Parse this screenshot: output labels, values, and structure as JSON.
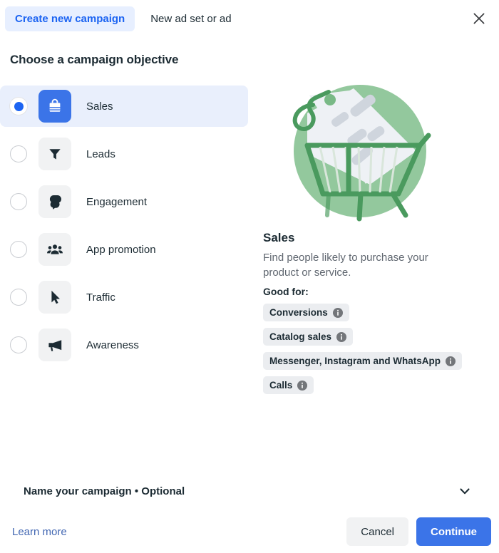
{
  "header": {
    "tabs": [
      {
        "label": "Create new campaign",
        "active": true
      },
      {
        "label": "New ad set or ad",
        "active": false
      }
    ],
    "close_icon": "close-icon"
  },
  "section": {
    "title": "Choose a campaign objective"
  },
  "objectives": [
    {
      "label": "Sales",
      "icon": "shopping-bag-icon",
      "selected": true
    },
    {
      "label": "Leads",
      "icon": "funnel-icon",
      "selected": false
    },
    {
      "label": "Engagement",
      "icon": "chat-bubbles-icon",
      "selected": false
    },
    {
      "label": "App promotion",
      "icon": "people-group-icon",
      "selected": false
    },
    {
      "label": "Traffic",
      "icon": "cursor-arrow-icon",
      "selected": false
    },
    {
      "label": "Awareness",
      "icon": "megaphone-icon",
      "selected": false
    }
  ],
  "detail": {
    "illustration": "shopping-cart-with-price-tag-illustration",
    "title": "Sales",
    "description": "Find people likely to purchase your product or service.",
    "good_for_label": "Good for:",
    "chips": [
      {
        "label": "Conversions",
        "info_icon": "info-icon"
      },
      {
        "label": "Catalog sales",
        "info_icon": "info-icon"
      },
      {
        "label": "Messenger, Instagram and WhatsApp",
        "info_icon": "info-icon"
      },
      {
        "label": "Calls",
        "info_icon": "info-icon"
      }
    ]
  },
  "name_section": {
    "label": "Name your campaign • Optional",
    "chevron_icon": "chevron-down-icon"
  },
  "footer": {
    "learn_more": "Learn more",
    "cancel": "Cancel",
    "continue": "Continue"
  },
  "colors": {
    "accent_blue": "#3b74e8",
    "tab_blue": "#1c64f2",
    "tab_pill_bg": "#e7efff",
    "selected_row_bg": "#e9effc",
    "tile_bg": "#f1f2f3",
    "chip_bg": "#ebedf0",
    "link_blue": "#4267b2",
    "illustration_green": "#8fc79a",
    "illustration_green_dark": "#4a9a5e"
  }
}
